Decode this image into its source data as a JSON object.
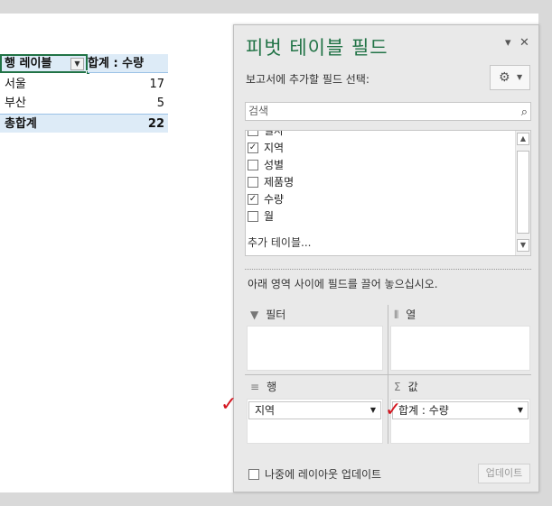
{
  "pivot": {
    "header_row_label": "행 레이블",
    "header_sum": "합계 : 수량",
    "rows": [
      {
        "label": "서울",
        "value": "17"
      },
      {
        "label": "부산",
        "value": "5"
      }
    ],
    "total_label": "총합계",
    "total_value": "22"
  },
  "pane": {
    "title": "피벗 테이블 필드",
    "subtitle": "보고서에 추가할 필드 선택:",
    "search_placeholder": "검색",
    "fields": [
      {
        "label": "일자",
        "checked": false
      },
      {
        "label": "지역",
        "checked": true
      },
      {
        "label": "성별",
        "checked": false
      },
      {
        "label": "제품명",
        "checked": false
      },
      {
        "label": "수량",
        "checked": true
      },
      {
        "label": "월",
        "checked": false
      }
    ],
    "more_tables": "추가 테이블...",
    "instruction": "아래 영역 사이에 필드를 끌어 놓으십시오.",
    "areas": {
      "filter": "필터",
      "columns": "열",
      "rows": "행",
      "values": "값"
    },
    "rows_chip": "지역",
    "values_chip": "합계 : 수량",
    "defer_label": "나중에 레이아웃 업데이트",
    "update_button": "업데이트"
  },
  "colors": {
    "title_green": "#217346",
    "pivot_header_blue": "#ddebf7",
    "annotation_red": "#d4141e"
  }
}
